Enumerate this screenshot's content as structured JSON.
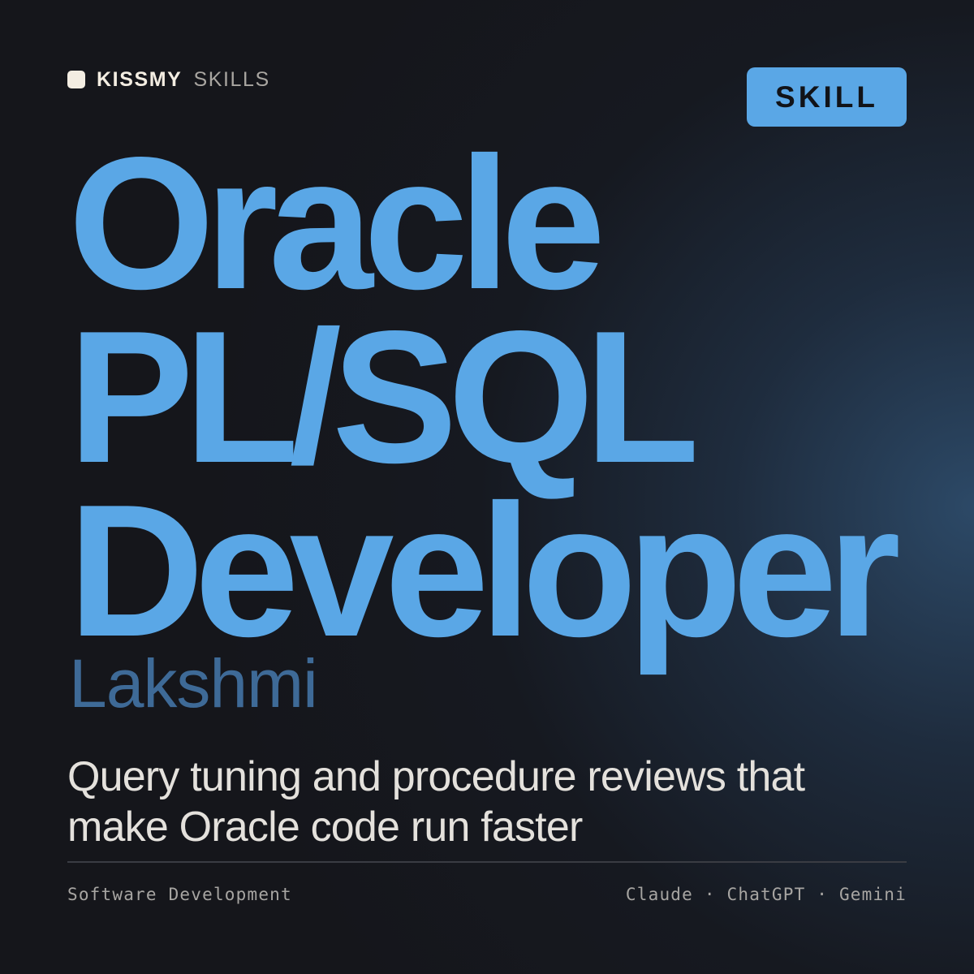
{
  "brand": {
    "name_bold": "KISSMY",
    "name_light": "SKILLS",
    "mark_icon": "square-logo-icon"
  },
  "badge": {
    "label": "SKILL"
  },
  "title": {
    "lines": [
      "Oracle",
      "PL/SQL",
      "Developer"
    ]
  },
  "author": "Lakshmi",
  "description": "Query tuning and procedure reviews that make Oracle code run faster",
  "footer": {
    "category": "Software Development",
    "platforms": "Claude · ChatGPT · Gemini"
  },
  "colors": {
    "accent": "#5aa7e6",
    "author": "#3e6a97",
    "background": "#15161b",
    "text": "#e4e1dc",
    "muted": "#a7a5a2"
  }
}
